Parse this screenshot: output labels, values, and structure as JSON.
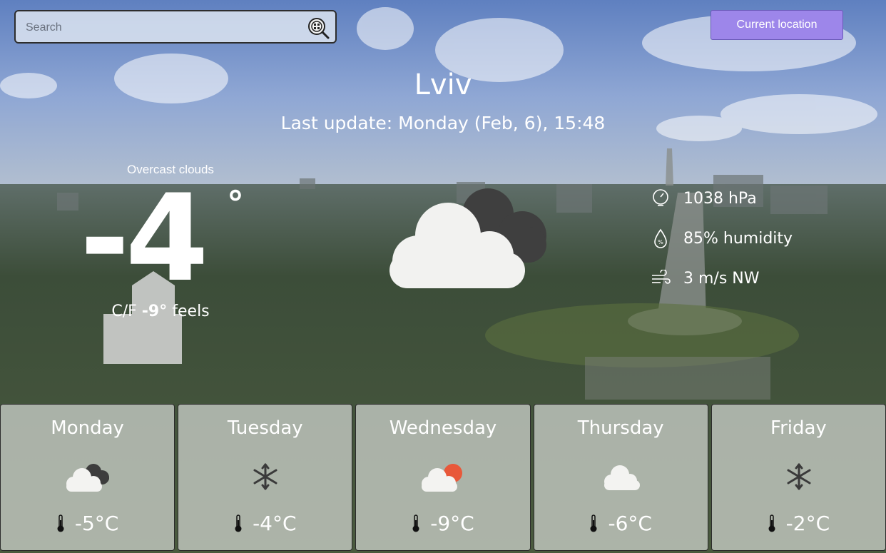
{
  "search": {
    "placeholder": "Search"
  },
  "header": {
    "current_location_label": "Current location"
  },
  "current": {
    "city": "Lviv",
    "last_update": "Last update: Monday (Feb, 6), 15:48",
    "description": "Overcast clouds",
    "temperature": "-4",
    "degree_symbol": "°",
    "units": "C/F",
    "feels_value": "-9°",
    "feels_label": "feels",
    "icon": "overcast-clouds-icon",
    "pressure": "1038 hPa",
    "humidity": "85% humidity",
    "wind": "3 m/s NW"
  },
  "forecast": [
    {
      "day": "Monday",
      "icon": "overcast-clouds-icon",
      "temp": "-5°C"
    },
    {
      "day": "Tuesday",
      "icon": "snowflake-icon",
      "temp": "-4°C"
    },
    {
      "day": "Wednesday",
      "icon": "sun-behind-cloud-icon",
      "temp": "-9°C"
    },
    {
      "day": "Thursday",
      "icon": "cloud-icon",
      "temp": "-6°C"
    },
    {
      "day": "Friday",
      "icon": "snowflake-icon",
      "temp": "-2°C"
    }
  ],
  "colors": {
    "button_bg": "#9d86ea",
    "sun": "#e8583a",
    "card_bg": "#c8cdc6"
  }
}
